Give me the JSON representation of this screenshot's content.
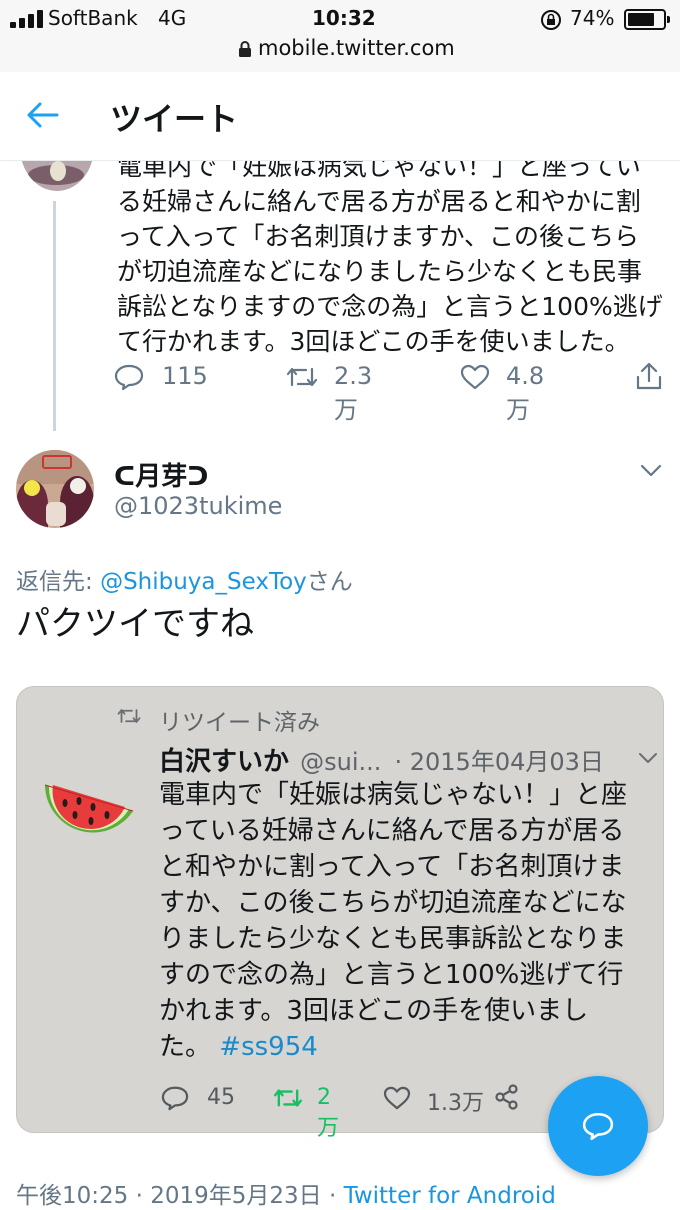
{
  "status_bar": {
    "carrier": "SoftBank",
    "network": "4G",
    "time": "10:32",
    "battery": "74%",
    "url": "mobile.twitter.com"
  },
  "header": {
    "title": "ツイート"
  },
  "parent_tweet": {
    "text_lines": [
      "電車内で「妊娠は病気じゃない！」と座ってい",
      "る妊婦さんに絡んで居る方が居ると和やかに割",
      "って入って「お名刺頂けますか、この後こちら",
      "が切迫流産などになりましたら少なくとも民事",
      "訴訟となりますので念の為」と言うと100%逃げ",
      "て行かれます。3回ほどこの手を使いました。"
    ],
    "replies": "115",
    "retweets": "2.3万",
    "likes": "4.8万"
  },
  "tweet": {
    "display_name": "ᑕ月芽ᑐ",
    "handle": "@1023tukime",
    "reply_prefix": "返信先: ",
    "reply_to": "@Shibuya_SexToy",
    "reply_suffix": "さん",
    "text": "パクツイですね",
    "timestamp": "午後10:25 · 2019年5月23日 · ",
    "source": "Twitter for Android"
  },
  "quoted": {
    "retweeted_label": "リツイート済み",
    "display_name": "白沢すいか",
    "handle": "@sui...",
    "date": "· 2015年04月03日",
    "text_lines": [
      "電車内で「妊娠は病気じゃない！」と座",
      "っている妊婦さんに絡んで居る方が居る",
      "と和やかに割って入って「お名刺頂けま",
      "すか、この後こちらが切迫流産などにな",
      "りましたら少なくとも民事訴訟となりま",
      "すので念の為」と言うと100%逃げて行",
      "かれます。3回ほどこの手を使いまし"
    ],
    "text_last": "た。",
    "hashtag": "#ss954",
    "replies": "45",
    "retweets": "2万",
    "likes": "1.3万"
  },
  "colors": {
    "accent": "#1da1f2",
    "link": "#1b95e0",
    "retweet_green": "#17bf63",
    "muted": "#657786"
  }
}
